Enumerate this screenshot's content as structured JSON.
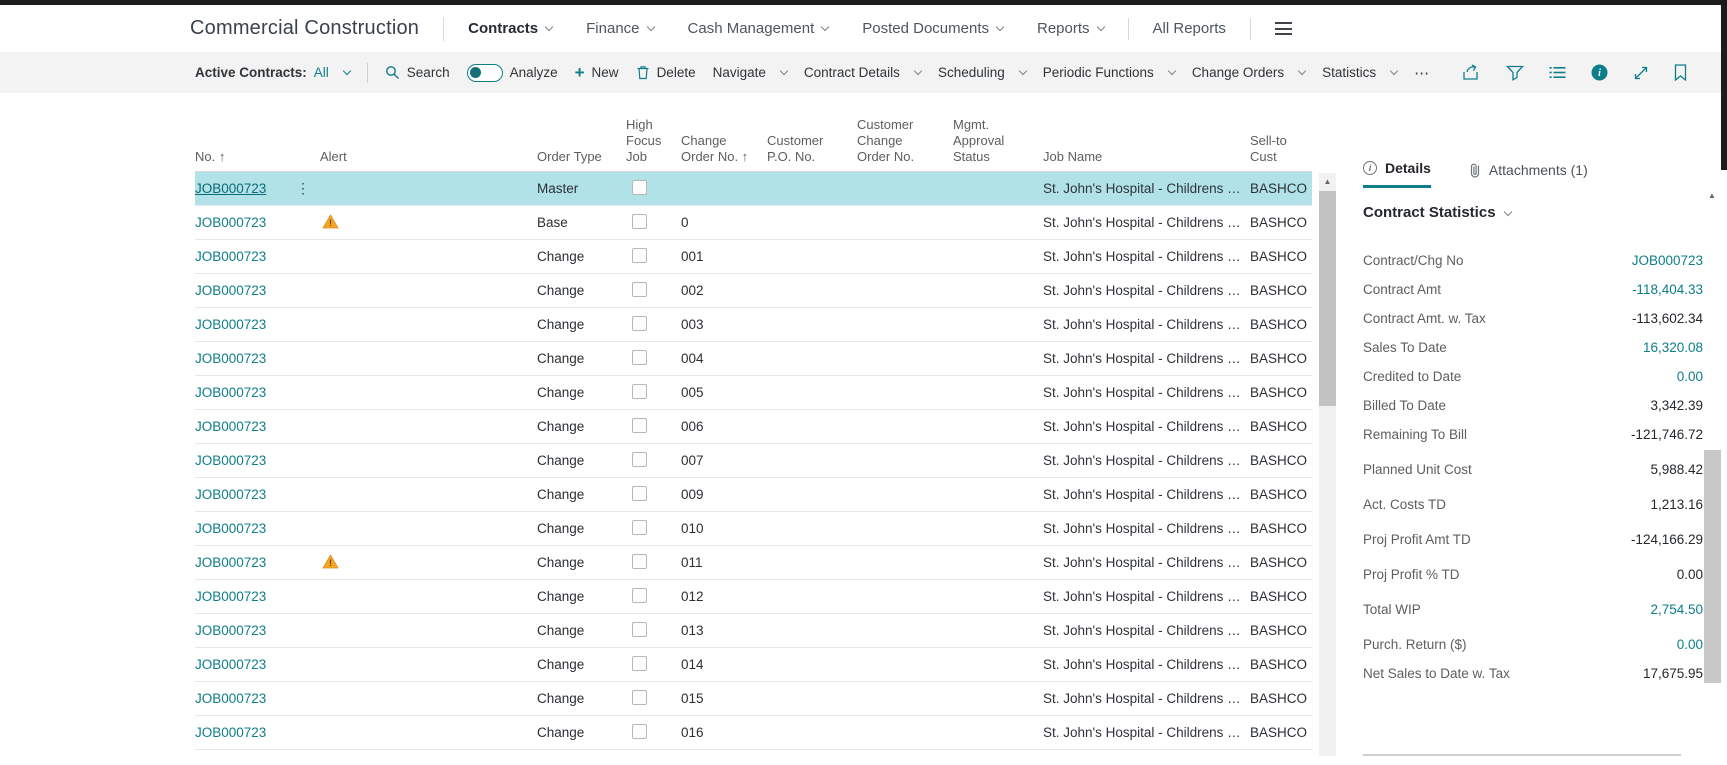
{
  "colors": {
    "accent_teal": "#0e7e8a",
    "selected_row_bg": "#b1e2e8",
    "warning_orange": "#f5a623",
    "top_bar_black": "#1c1c1c",
    "action_bar_bg": "#f3f3f3"
  },
  "top_bar": {
    "title": "Commercial Construction",
    "menus": [
      {
        "label": "Contracts",
        "active": true
      },
      {
        "label": "Finance",
        "active": false
      },
      {
        "label": "Cash Management",
        "active": false
      },
      {
        "label": "Posted Documents",
        "active": false
      },
      {
        "label": "Reports",
        "active": false
      }
    ],
    "all_reports_label": "All Reports"
  },
  "action_bar": {
    "view_label": "Active Contracts:",
    "view_value": "All",
    "search_label": "Search",
    "analyze_label": "Analyze",
    "new_label": "New",
    "delete_label": "Delete",
    "menus": [
      "Navigate",
      "Contract Details",
      "Scheduling",
      "Periodic Functions",
      "Change Orders",
      "Statistics"
    ],
    "more_label": "⋯",
    "right_icons": [
      "share-icon",
      "filter-icon",
      "show-list-icon",
      "info-icon",
      "expand-icon",
      "bookmark-icon"
    ]
  },
  "table": {
    "columns": [
      {
        "key": "no",
        "label": "No. ↑"
      },
      {
        "key": "menu",
        "label": ""
      },
      {
        "key": "alert",
        "label": "Alert"
      },
      {
        "key": "order_type",
        "label": "Order Type"
      },
      {
        "key": "high_focus",
        "label": "High\nFocus\nJob"
      },
      {
        "key": "change_no",
        "label": "Change\nOrder No. ↑"
      },
      {
        "key": "cust_po",
        "label": "Customer\nP.O. No."
      },
      {
        "key": "cust_chg",
        "label": "Customer\nChange\nOrder No."
      },
      {
        "key": "mgmt",
        "label": "Mgmt.\nApproval\nStatus"
      },
      {
        "key": "job_name",
        "label": "Job Name"
      },
      {
        "key": "sell_to",
        "label": "Sell-to Cust"
      }
    ],
    "rows": [
      {
        "no": "JOB000723",
        "row_menu": true,
        "alert": false,
        "order_type": "Master",
        "high_focus": false,
        "change_no": "",
        "cust_po": "",
        "cust_chg": "",
        "mgmt": "",
        "job_name": "St. John's Hospital - Childrens …",
        "sell_to": "BASHCO",
        "selected": true
      },
      {
        "no": "JOB000723",
        "row_menu": false,
        "alert": true,
        "order_type": "Base",
        "high_focus": false,
        "change_no": "0",
        "cust_po": "",
        "cust_chg": "",
        "mgmt": "",
        "job_name": "St. John's Hospital - Childrens …",
        "sell_to": "BASHCO",
        "selected": false
      },
      {
        "no": "JOB000723",
        "row_menu": false,
        "alert": false,
        "order_type": "Change",
        "high_focus": false,
        "change_no": "001",
        "cust_po": "",
        "cust_chg": "",
        "mgmt": "",
        "job_name": "St. John's Hospital - Childrens …",
        "sell_to": "BASHCO",
        "selected": false
      },
      {
        "no": "JOB000723",
        "row_menu": false,
        "alert": false,
        "order_type": "Change",
        "high_focus": false,
        "change_no": "002",
        "cust_po": "",
        "cust_chg": "",
        "mgmt": "",
        "job_name": "St. John's Hospital - Childrens …",
        "sell_to": "BASHCO",
        "selected": false
      },
      {
        "no": "JOB000723",
        "row_menu": false,
        "alert": false,
        "order_type": "Change",
        "high_focus": false,
        "change_no": "003",
        "cust_po": "",
        "cust_chg": "",
        "mgmt": "",
        "job_name": "St. John's Hospital - Childrens …",
        "sell_to": "BASHCO",
        "selected": false
      },
      {
        "no": "JOB000723",
        "row_menu": false,
        "alert": false,
        "order_type": "Change",
        "high_focus": false,
        "change_no": "004",
        "cust_po": "",
        "cust_chg": "",
        "mgmt": "",
        "job_name": "St. John's Hospital - Childrens …",
        "sell_to": "BASHCO",
        "selected": false
      },
      {
        "no": "JOB000723",
        "row_menu": false,
        "alert": false,
        "order_type": "Change",
        "high_focus": false,
        "change_no": "005",
        "cust_po": "",
        "cust_chg": "",
        "mgmt": "",
        "job_name": "St. John's Hospital - Childrens …",
        "sell_to": "BASHCO",
        "selected": false
      },
      {
        "no": "JOB000723",
        "row_menu": false,
        "alert": false,
        "order_type": "Change",
        "high_focus": false,
        "change_no": "006",
        "cust_po": "",
        "cust_chg": "",
        "mgmt": "",
        "job_name": "St. John's Hospital - Childrens …",
        "sell_to": "BASHCO",
        "selected": false
      },
      {
        "no": "JOB000723",
        "row_menu": false,
        "alert": false,
        "order_type": "Change",
        "high_focus": false,
        "change_no": "007",
        "cust_po": "",
        "cust_chg": "",
        "mgmt": "",
        "job_name": "St. John's Hospital - Childrens …",
        "sell_to": "BASHCO",
        "selected": false
      },
      {
        "no": "JOB000723",
        "row_menu": false,
        "alert": false,
        "order_type": "Change",
        "high_focus": false,
        "change_no": "009",
        "cust_po": "",
        "cust_chg": "",
        "mgmt": "",
        "job_name": "St. John's Hospital - Childrens …",
        "sell_to": "BASHCO",
        "selected": false
      },
      {
        "no": "JOB000723",
        "row_menu": false,
        "alert": false,
        "order_type": "Change",
        "high_focus": false,
        "change_no": "010",
        "cust_po": "",
        "cust_chg": "",
        "mgmt": "",
        "job_name": "St. John's Hospital - Childrens …",
        "sell_to": "BASHCO",
        "selected": false
      },
      {
        "no": "JOB000723",
        "row_menu": false,
        "alert": true,
        "order_type": "Change",
        "high_focus": false,
        "change_no": "011",
        "cust_po": "",
        "cust_chg": "",
        "mgmt": "",
        "job_name": "St. John's Hospital - Childrens …",
        "sell_to": "BASHCO",
        "selected": false
      },
      {
        "no": "JOB000723",
        "row_menu": false,
        "alert": false,
        "order_type": "Change",
        "high_focus": false,
        "change_no": "012",
        "cust_po": "",
        "cust_chg": "",
        "mgmt": "",
        "job_name": "St. John's Hospital - Childrens …",
        "sell_to": "BASHCO",
        "selected": false
      },
      {
        "no": "JOB000723",
        "row_menu": false,
        "alert": false,
        "order_type": "Change",
        "high_focus": false,
        "change_no": "013",
        "cust_po": "",
        "cust_chg": "",
        "mgmt": "",
        "job_name": "St. John's Hospital - Childrens …",
        "sell_to": "BASHCO",
        "selected": false
      },
      {
        "no": "JOB000723",
        "row_menu": false,
        "alert": false,
        "order_type": "Change",
        "high_focus": false,
        "change_no": "014",
        "cust_po": "",
        "cust_chg": "",
        "mgmt": "",
        "job_name": "St. John's Hospital - Childrens …",
        "sell_to": "BASHCO",
        "selected": false
      },
      {
        "no": "JOB000723",
        "row_menu": false,
        "alert": false,
        "order_type": "Change",
        "high_focus": false,
        "change_no": "015",
        "cust_po": "",
        "cust_chg": "",
        "mgmt": "",
        "job_name": "St. John's Hospital - Childrens …",
        "sell_to": "BASHCO",
        "selected": false
      },
      {
        "no": "JOB000723",
        "row_menu": false,
        "alert": false,
        "order_type": "Change",
        "high_focus": false,
        "change_no": "016",
        "cust_po": "",
        "cust_chg": "",
        "mgmt": "",
        "job_name": "St. John's Hospital - Childrens …",
        "sell_to": "BASHCO",
        "selected": false
      }
    ]
  },
  "details_panel": {
    "tabs": [
      {
        "label": "Details",
        "icon": "info-outline-icon",
        "active": true
      },
      {
        "label": "Attachments (1)",
        "icon": "paperclip-icon",
        "active": false
      }
    ],
    "section_title": "Contract Statistics",
    "fields": [
      {
        "label": "Contract/Chg No",
        "value": "JOB000723",
        "link": true,
        "gap": false
      },
      {
        "label": "Contract Amt",
        "value": "-118,404.33",
        "link": true,
        "gap": false
      },
      {
        "label": "Contract Amt. w. Tax",
        "value": "-113,602.34",
        "link": false,
        "gap": false
      },
      {
        "label": "Sales To Date",
        "value": "16,320.08",
        "link": true,
        "gap": false
      },
      {
        "label": "Credited to Date",
        "value": "0.00",
        "link": true,
        "gap": false
      },
      {
        "label": "Billed To Date",
        "value": "3,342.39",
        "link": false,
        "gap": false
      },
      {
        "label": "Remaining To Bill",
        "value": "-121,746.72",
        "link": false,
        "gap": false
      },
      {
        "label": "Planned Unit Cost",
        "value": "5,988.42",
        "link": false,
        "gap": true
      },
      {
        "label": "Act. Costs TD",
        "value": "1,213.16",
        "link": false,
        "gap": true
      },
      {
        "label": "Proj Profit Amt TD",
        "value": "-124,166.29",
        "link": false,
        "gap": true
      },
      {
        "label": "Proj Profit % TD",
        "value": "0.00",
        "link": false,
        "gap": true
      },
      {
        "label": "Total WIP",
        "value": "2,754.50",
        "link": true,
        "gap": true
      },
      {
        "label": "Purch. Return ($)",
        "value": "0.00",
        "link": true,
        "gap": true
      },
      {
        "label": "Net Sales to Date w. Tax",
        "value": "17,675.95",
        "link": false,
        "gap": false
      }
    ]
  }
}
